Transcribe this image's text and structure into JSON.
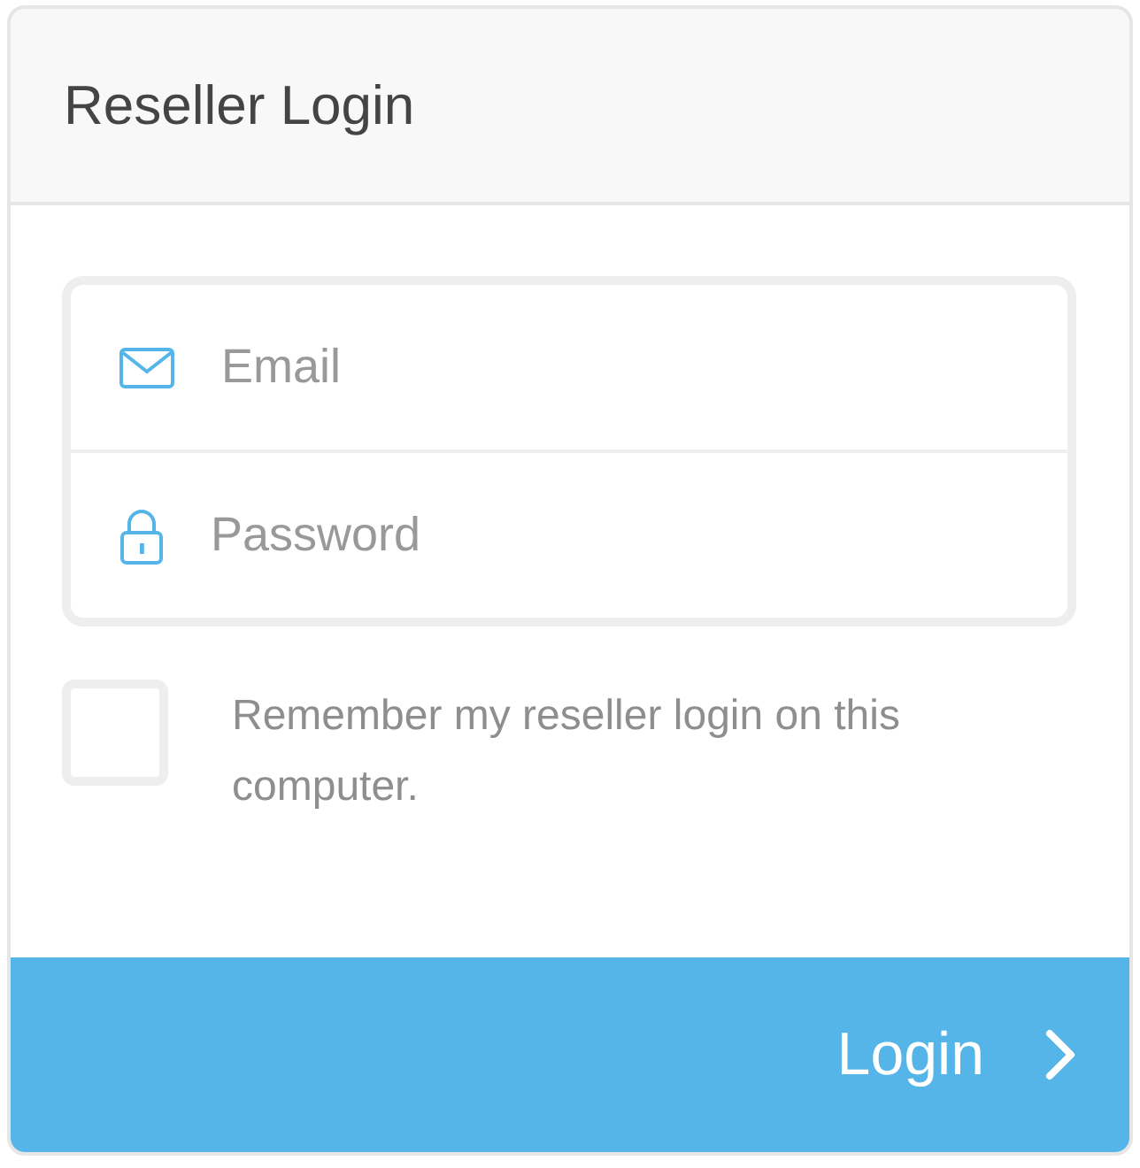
{
  "panel": {
    "title": "Reseller Login"
  },
  "fields": [
    {
      "kind": "email",
      "placeholder": "Email"
    },
    {
      "kind": "password",
      "placeholder": "Password"
    }
  ],
  "remember": {
    "label": "Remember my reseller login on this computer.",
    "checked": false
  },
  "submit": {
    "label": "Login"
  }
}
